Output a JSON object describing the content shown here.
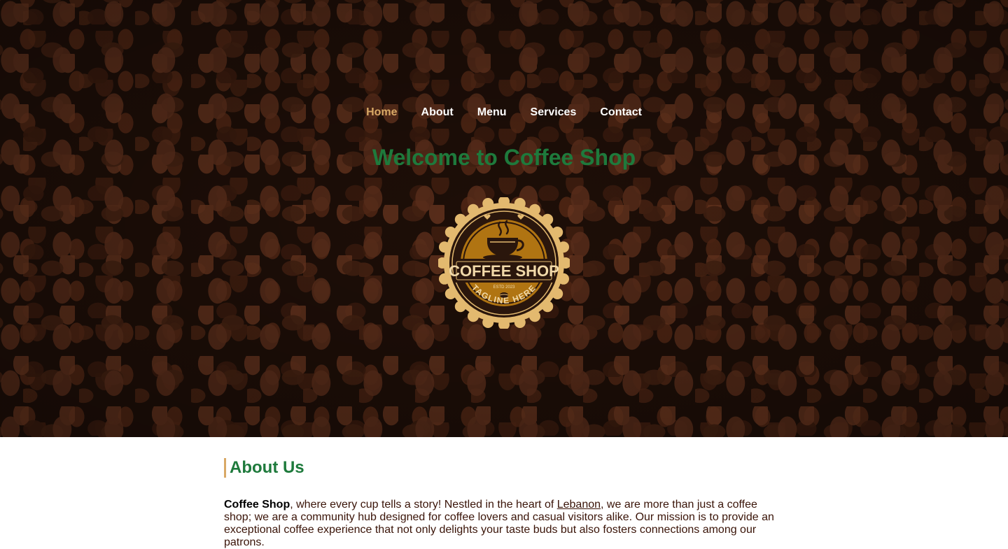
{
  "nav": {
    "items": [
      {
        "label": "Home",
        "active": true
      },
      {
        "label": "About",
        "active": false
      },
      {
        "label": "Menu",
        "active": false
      },
      {
        "label": "Services",
        "active": false
      },
      {
        "label": "Contact",
        "active": false
      }
    ]
  },
  "hero": {
    "title": "Welcome to Coffee Shop"
  },
  "logo": {
    "name": "COFFEE SHOP",
    "estd": "ESTD 2023",
    "tagline": "TAGLINE HERE"
  },
  "about": {
    "title": "About Us",
    "brand": "Coffee Shop",
    "text_part1": ", where every cup tells a story! Nestled in the heart of ",
    "location_link": "Lebanon",
    "text_part2": ", we are more than just a coffee shop; we are a community hub designed for coffee lovers and casual visitors alike. Our mission is to provide an exceptional coffee experience that not only delights your taste buds but also fosters connections among our patrons."
  },
  "colors": {
    "accent_green": "#1e7a3c",
    "accent_gold": "#d9a966",
    "text_brown": "#3a1408",
    "hero_background": "#1f0f08"
  }
}
